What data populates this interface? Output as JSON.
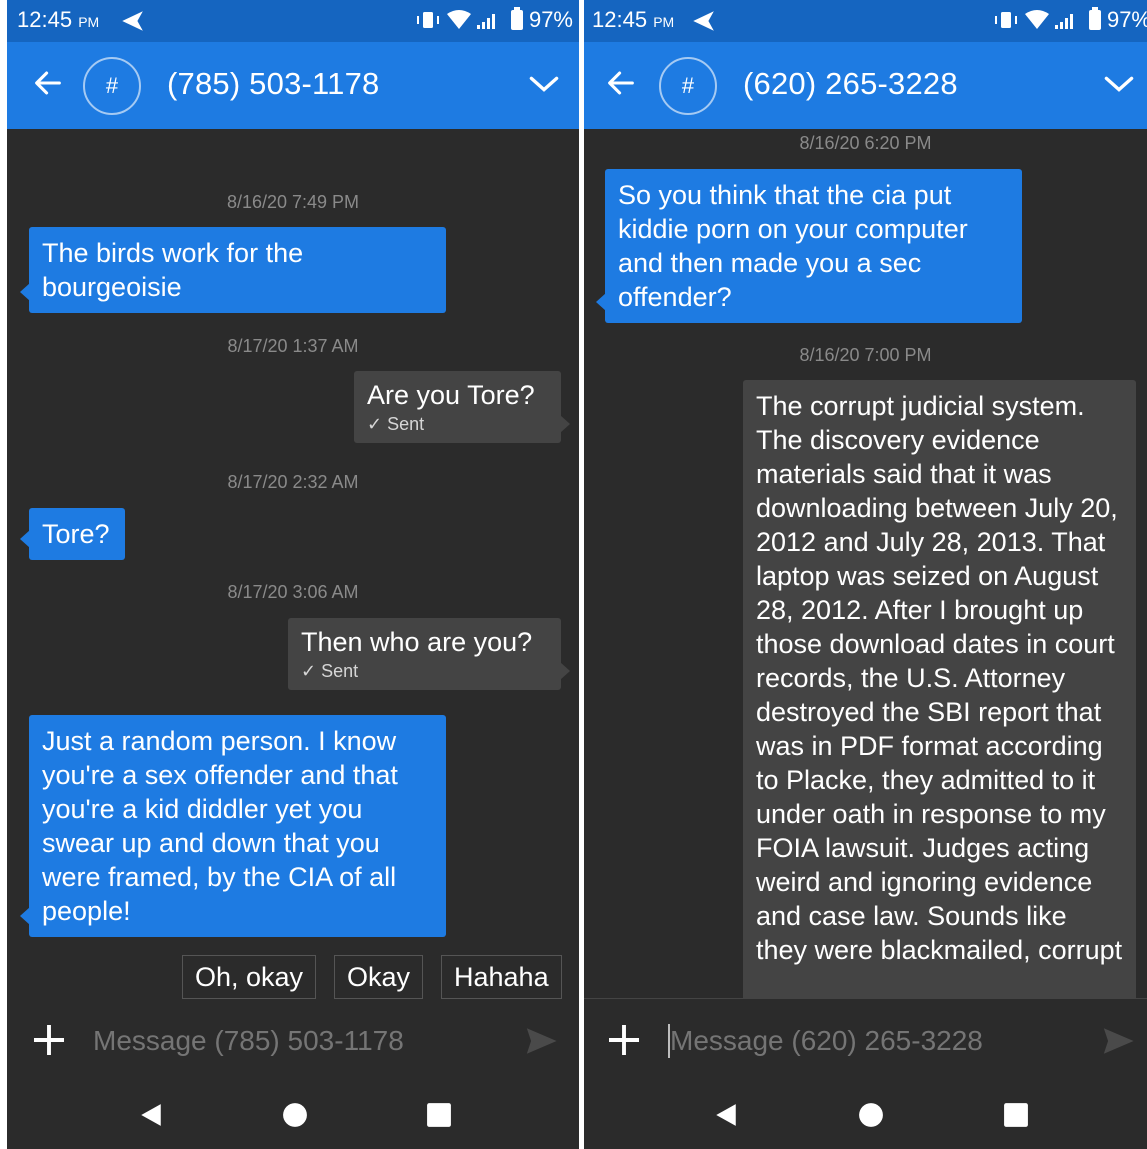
{
  "left": {
    "status": {
      "time": "12:45",
      "ampm": "PM",
      "battery": "97%"
    },
    "header": {
      "avatar": "#",
      "contact": "(785) 503-1178"
    },
    "messages": [
      {
        "type": "timestamp",
        "text": "8/16/20 7:49 PM"
      },
      {
        "type": "incoming",
        "text": "The birds work for the bourgeoisie"
      },
      {
        "type": "timestamp",
        "text": "8/17/20 1:37 AM"
      },
      {
        "type": "outgoing",
        "text": "Are you Tore?",
        "status": "✓ Sent"
      },
      {
        "type": "timestamp",
        "text": "8/17/20 2:32 AM"
      },
      {
        "type": "incoming",
        "text": "Tore?"
      },
      {
        "type": "timestamp",
        "text": "8/17/20 3:06 AM"
      },
      {
        "type": "outgoing",
        "text": "Then who are you?",
        "status": "✓ Sent"
      },
      {
        "type": "incoming",
        "text": "Just a random person. I know you're a sex offender and that you're a kid diddler yet you swear up and down that you were framed, by the CIA of all people!"
      }
    ],
    "quick_replies": [
      "Oh, okay",
      "Okay",
      "Hahaha"
    ],
    "composer": {
      "placeholder": "Message (785) 503-1178"
    }
  },
  "right": {
    "status": {
      "time": "12:45",
      "ampm": "PM",
      "battery": "97%"
    },
    "header": {
      "avatar": "#",
      "contact": "(620) 265-3228"
    },
    "messages": [
      {
        "type": "timestamp",
        "text": "8/16/20 6:20 PM"
      },
      {
        "type": "incoming",
        "text": "So you think that the cia put kiddie porn on your computer and then made you a sec offender?"
      },
      {
        "type": "timestamp",
        "text": "8/16/20 7:00 PM"
      },
      {
        "type": "outgoing",
        "text": "The corrupt judicial system. The discovery evidence materials said that it was downloading between July 20, 2012 and July 28, 2013. That laptop was seized on August 28, 2012. After I brought up those download dates in court records, the U.S. Attorney destroyed the SBI report that was in PDF format according to Placke, they admitted to it under oath in response to my FOIA lawsuit. Judges acting weird and ignoring evidence and case law. Sounds like they were blackmailed, corrupt"
      }
    ],
    "composer": {
      "placeholder": "Message (620) 265-3228"
    }
  },
  "colors": {
    "statusbar": "#1565c0",
    "appbar": "#1e7be2",
    "background": "#2b2b2b",
    "incoming": "#1e7be2",
    "outgoing": "#444444"
  }
}
